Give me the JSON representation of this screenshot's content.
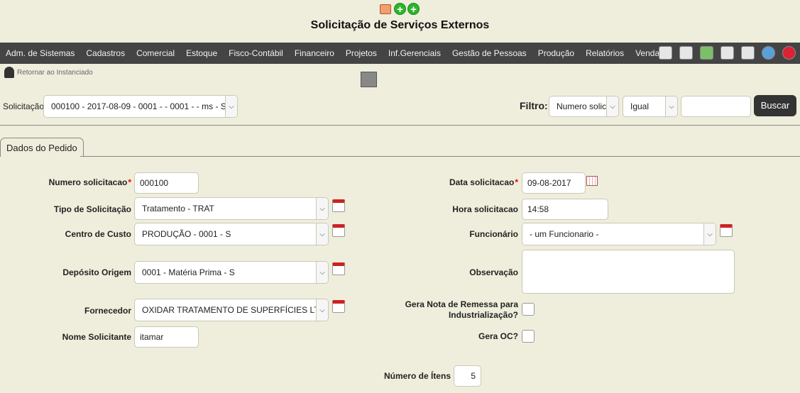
{
  "header": {
    "title": "Solicitação de Serviços Externos",
    "top_icons": [
      "document-icon",
      "add-icon",
      "add-icon"
    ]
  },
  "menu": {
    "items": [
      "Adm. de Sistemas",
      "Cadastros",
      "Comercial",
      "Estoque",
      "Fisco-Contábil",
      "Financeiro",
      "Projetos",
      "Inf.Gerenciais",
      "Gestão de Pessoas",
      "Produção",
      "Relatórios",
      "Vendas"
    ],
    "icons": [
      "home-icon",
      "print-icon",
      "recycle-icon",
      "doc-edit-icon",
      "doc-icon",
      "globe-icon",
      "power-icon"
    ]
  },
  "back_link": {
    "label": "Retornar ao Instanciado"
  },
  "top_form": {
    "solicitacao_label": "Solicitação",
    "solicitacao_value": "000100 - 2017-08-09 - 0001 - - 0001 - - ms - S",
    "filtro_label": "Filtro:",
    "filtro_field_value": "Numero solic",
    "filtro_op_value": "Igual",
    "search_value": "",
    "buscar_label": "Buscar"
  },
  "tabs": {
    "active": "Dados do Pedido"
  },
  "form": {
    "numero_label": "Numero solicitacao",
    "numero_value": "000100",
    "tipo_label": "Tipo de Solicitação",
    "tipo_value": "Tratamento - TRAT",
    "centro_label": "Centro de Custo",
    "centro_value": "PRODUÇÃO - 0001 - S",
    "deposito_label": "Depósito Origem",
    "deposito_value": "0001 - Matéria Prima - S",
    "fornecedor_label": "Fornecedor",
    "fornecedor_value": "OXIDAR TRATAMENTO DE SUPERFÍCIES LTDA - OX",
    "nome_label": "Nome Solicitante",
    "nome_value": "itamar",
    "data_label": "Data solicitacao",
    "data_value": "09-08-2017",
    "hora_label": "Hora solicitacao",
    "hora_value": "14:58",
    "funcionario_label": "Funcionário",
    "funcionario_value": "- um Funcionario -",
    "observacao_label": "Observação",
    "observacao_value": "",
    "gera_nota_label_1": "Gera Nota de Remessa para",
    "gera_nota_label_2": "Industrialização?",
    "gera_oc_label": "Gera OC?",
    "numero_itens_label": "Número de Ítens",
    "numero_itens_value": "5"
  }
}
